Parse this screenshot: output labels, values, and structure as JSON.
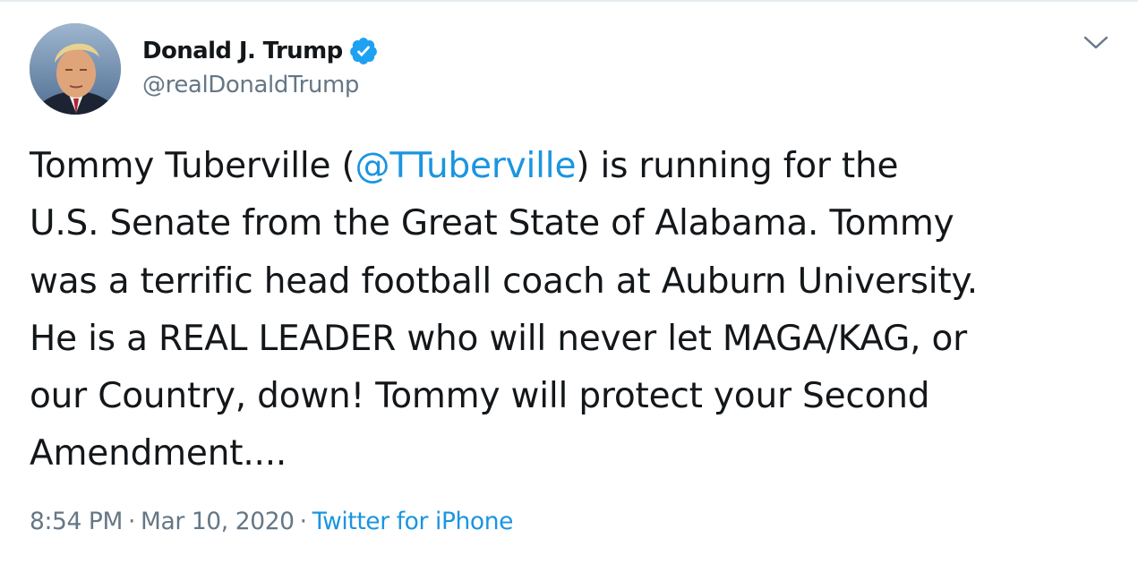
{
  "tweet": {
    "author": {
      "display_name": "Donald J. Trump",
      "handle": "@realDonaldTrump",
      "verified": true
    },
    "text_lines": [
      {
        "before": "Tommy Tuberville (",
        "mention": "@TTuberville",
        "after": ") is running for the"
      },
      {
        "text": "U.S. Senate from the Great State of Alabama. Tommy"
      },
      {
        "text": "was a terrific head football coach at Auburn University."
      },
      {
        "text": "He is a REAL LEADER who will never let MAGA/KAG, or"
      },
      {
        "text": "our Country, down! Tommy will protect your Second"
      },
      {
        "text": "Amendment...."
      }
    ],
    "meta": {
      "time": "8:54 PM",
      "separator": "·",
      "date": "Mar 10, 2020",
      "source": "Twitter for iPhone"
    }
  },
  "icons": {
    "verified": "verified-badge-icon",
    "menu": "chevron-down-icon"
  },
  "colors": {
    "link": "#1b95e0",
    "text": "#14171a",
    "secondary": "#657786",
    "verified": "#1da1f2"
  }
}
